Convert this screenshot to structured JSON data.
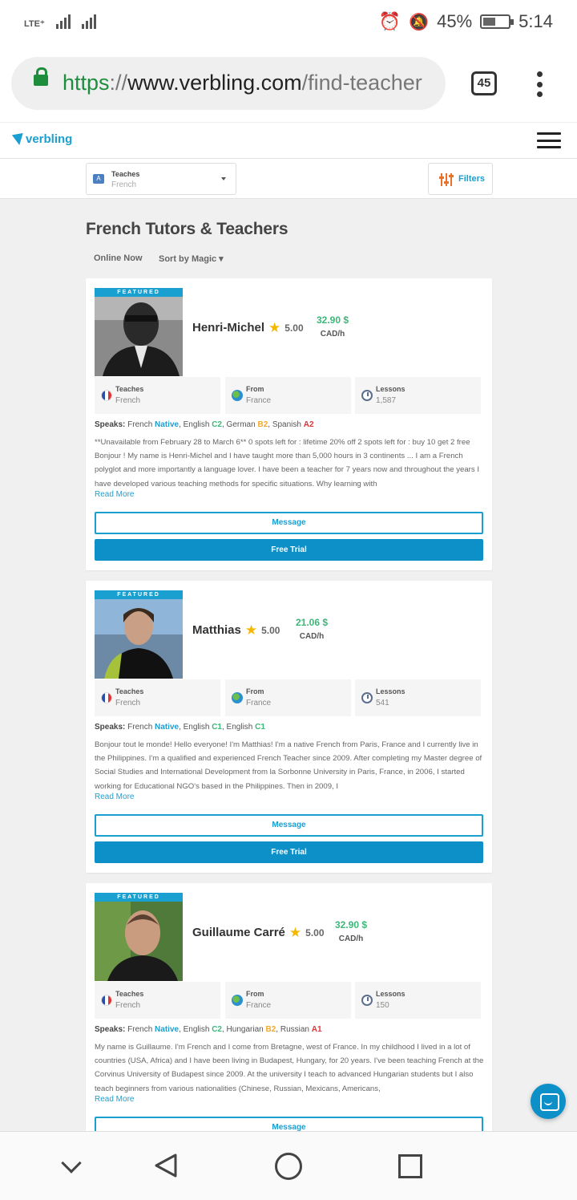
{
  "status_bar": {
    "network": "LTE⁺",
    "battery": "45%",
    "time": "5:14"
  },
  "browser": {
    "url_scheme": "https",
    "url_sep": "://",
    "url_host": "www.verbling.com",
    "url_path": "/find-teacher",
    "tab_count": "45"
  },
  "site": {
    "logo": "verbling"
  },
  "filters": {
    "teaches_label": "Teaches",
    "teaches_value": "French",
    "filters_label": "Filters"
  },
  "page": {
    "title": "French Tutors & Teachers",
    "online_now": "Online Now",
    "sort_by": "Sort by Magic ▾"
  },
  "common": {
    "featured": "FEATURED",
    "teaches_label": "Teaches",
    "from_label": "From",
    "lessons_label": "Lessons",
    "speaks_label": "Speaks:",
    "read_more": "Read More",
    "message": "Message",
    "free_trial": "Free Trial"
  },
  "tutors": [
    {
      "name": "Henri-Michel",
      "rating": "5.00",
      "price": "32.90 $",
      "unit": "CAD/h",
      "teaches": "French",
      "from": "France",
      "lessons": "1,587",
      "speaks": [
        {
          "lang": "French",
          "level": "Native",
          "sep": ", "
        },
        {
          "lang": "English",
          "level": "C2",
          "sep": ", "
        },
        {
          "lang": "German",
          "level": "B2",
          "sep": ", "
        },
        {
          "lang": "Spanish",
          "level": "A2",
          "sep": ""
        }
      ],
      "description": "**Unavailable from February 28 to March 6** 0 spots left for : lifetime 20% off 2 spots left for : buy 10 get 2 free Bonjour ! My name is Henri-Michel and I have taught more than 5,000 hours in 3 continents ... I am a French polyglot and more importantly a language lover. I have been a teacher for 7 years now and throughout the years I have developed various teaching methods for specific situations. Why learning with"
    },
    {
      "name": "Matthias",
      "rating": "5.00",
      "price": "21.06 $",
      "unit": "CAD/h",
      "teaches": "French",
      "from": "France",
      "lessons": "541",
      "speaks": [
        {
          "lang": "French",
          "level": "Native",
          "sep": ", "
        },
        {
          "lang": "English",
          "level": "C1",
          "sep": ", "
        },
        {
          "lang": "English",
          "level": "C1",
          "sep": ""
        }
      ],
      "description": "Bonjour tout le monde! Hello everyone! I'm Matthias! I'm a native French from Paris, France and I currently live in the Philippines. I'm a qualified and experienced French Teacher since 2009. After completing my Master degree of Social Studies and International Development from la Sorbonne University in Paris, France, in 2006, I started working for Educational NGO's based in the Philippines. Then in 2009, I"
    },
    {
      "name": "Guillaume Carré",
      "rating": "5.00",
      "price": "32.90 $",
      "unit": "CAD/h",
      "teaches": "French",
      "from": "France",
      "lessons": "150",
      "speaks": [
        {
          "lang": "French",
          "level": "Native",
          "sep": ", "
        },
        {
          "lang": "English",
          "level": "C2",
          "sep": ", "
        },
        {
          "lang": "Hungarian",
          "level": "B2",
          "sep": ", "
        },
        {
          "lang": "Russian",
          "level": "A1",
          "sep": ""
        }
      ],
      "description": "My name is Guillaume. I'm French and I come from Bretagne, west of France. In my childhood I lived in a lot of countries (USA, Africa) and I have been living in Budapest, Hungary, for 20 years. I've been teaching French at the Corvinus University of Budapest since 2009. At the university I teach to advanced Hungarian students but I also teach beginners from various nationalities (Chinese, Russian, Mexicans, Americans,"
    }
  ],
  "colors": {
    "brand": "#1a9fd1",
    "price": "#3cb878",
    "button": "#0d8fc8"
  }
}
